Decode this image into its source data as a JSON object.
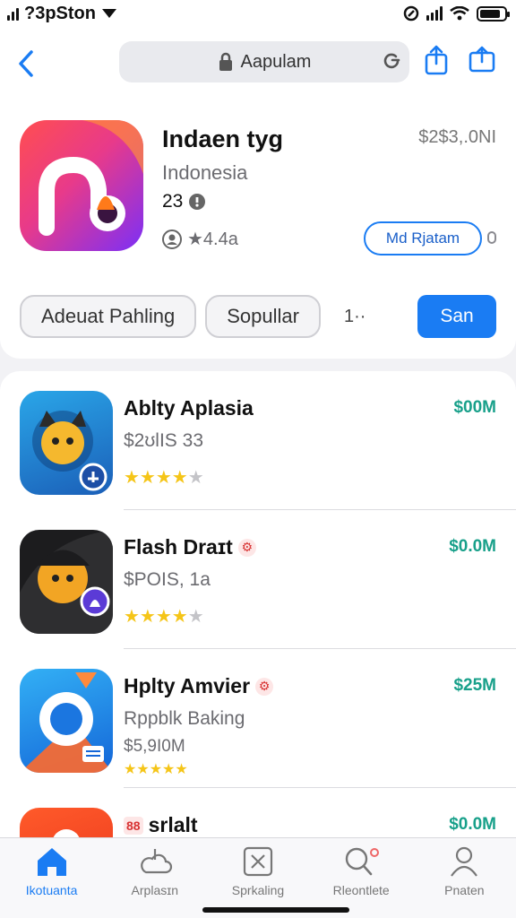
{
  "status": {
    "carrier": "?3pSton",
    "battery_level": 0.85
  },
  "nav": {
    "address": "Aapulam"
  },
  "hero": {
    "title": "Indaen tyg",
    "country": "Indonesia",
    "count": "23",
    "rating": "★4.4a",
    "price": "$2$3,.0NI",
    "get_label": "Md Rjatam"
  },
  "chips": [
    "Adeuat Pahling",
    "Sopullar"
  ],
  "chip_more": "1··",
  "search_label": "San",
  "apps": [
    {
      "title": "Ablty Aplasia",
      "subtitle": "$2ʊlIS 33",
      "price": "$00M",
      "stars": 4,
      "badge": ""
    },
    {
      "title": "Flash Draɪt",
      "subtitle": "$POIS, 1a",
      "price": "$0.0M",
      "stars": 4,
      "badge": "⚙"
    },
    {
      "title": "Hplty Amvier",
      "subtitle": "Rppblk Baking",
      "subtitle2": "$5,9I0M",
      "price": "$25M",
      "stars": 5,
      "badge": "⚙"
    },
    {
      "title": "srlalt",
      "subtitle": "",
      "price": "$0.0M",
      "stars": 0,
      "badge": "88"
    }
  ],
  "tabs": [
    {
      "label": "Ikotuanta",
      "icon": "home-icon",
      "active": true
    },
    {
      "label": "Arplasɪn",
      "icon": "cloud-icon",
      "active": false
    },
    {
      "label": "Sprkaling",
      "icon": "close-box-icon",
      "active": false
    },
    {
      "label": "Rleontlete",
      "icon": "search-icon",
      "active": false
    },
    {
      "label": "Pnaten",
      "icon": "person-icon",
      "active": false
    }
  ],
  "colors": {
    "accent": "#1a7cf3",
    "price": "#18a08a",
    "star": "#f5c518"
  }
}
